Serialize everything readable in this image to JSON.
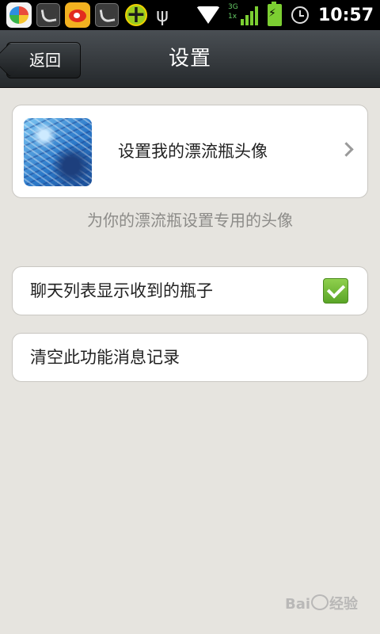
{
  "status_bar": {
    "time": "10:57",
    "network_label": "3G",
    "network_sub": "1x",
    "icons": [
      "app-store-icon",
      "notification-icon",
      "weibo-icon",
      "notification-icon",
      "security-plus-icon",
      "usb-icon",
      "wifi-icon",
      "signal-icon",
      "battery-charging-icon",
      "alarm-clock-icon"
    ]
  },
  "header": {
    "back_label": "返回",
    "title": "设置"
  },
  "avatar_setting": {
    "label": "设置我的漂流瓶头像",
    "hint": "为你的漂流瓶设置专用的头像"
  },
  "options": {
    "show_bottles_label": "聊天列表显示收到的瓶子",
    "show_bottles_checked": true,
    "clear_history_label": "清空此功能消息记录"
  },
  "watermark": {
    "text": "Bai",
    "text_suffix": "经验"
  },
  "colors": {
    "background": "#e6e4df",
    "checkbox_green": "#6cb82f"
  }
}
